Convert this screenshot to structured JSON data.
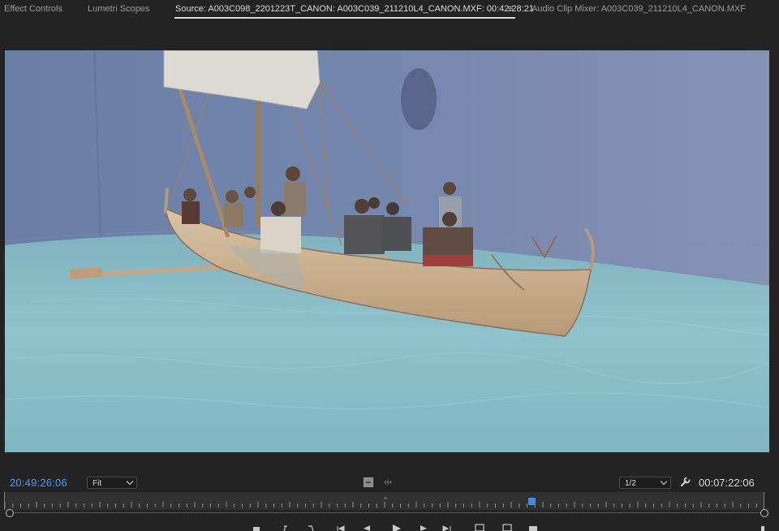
{
  "tabs": [
    {
      "label": "Effect Controls"
    },
    {
      "label": "Lumetri Scopes"
    },
    {
      "label": "Source: A003C098_2201223T_CANON: A003C039_211210L4_CANON.MXF: 00:42:28:21"
    },
    {
      "label": "Audio Clip Mixer: A003C039_211210L4_CANON.MXF"
    }
  ],
  "tab_menu_glyph": "≡",
  "monitor": {
    "scene": "boat-on-water-bluescreen"
  },
  "transport": {
    "playhead_timecode": "20:49:26:06",
    "zoom_select": "Fit",
    "resolution_select": "1/2",
    "duration_timecode": "00:07:22:06"
  },
  "colors": {
    "accent": "#3ea0f5",
    "background": "#232323"
  },
  "icons": {
    "wrench": "wrench-icon",
    "menu": "panel-menu-icon"
  }
}
